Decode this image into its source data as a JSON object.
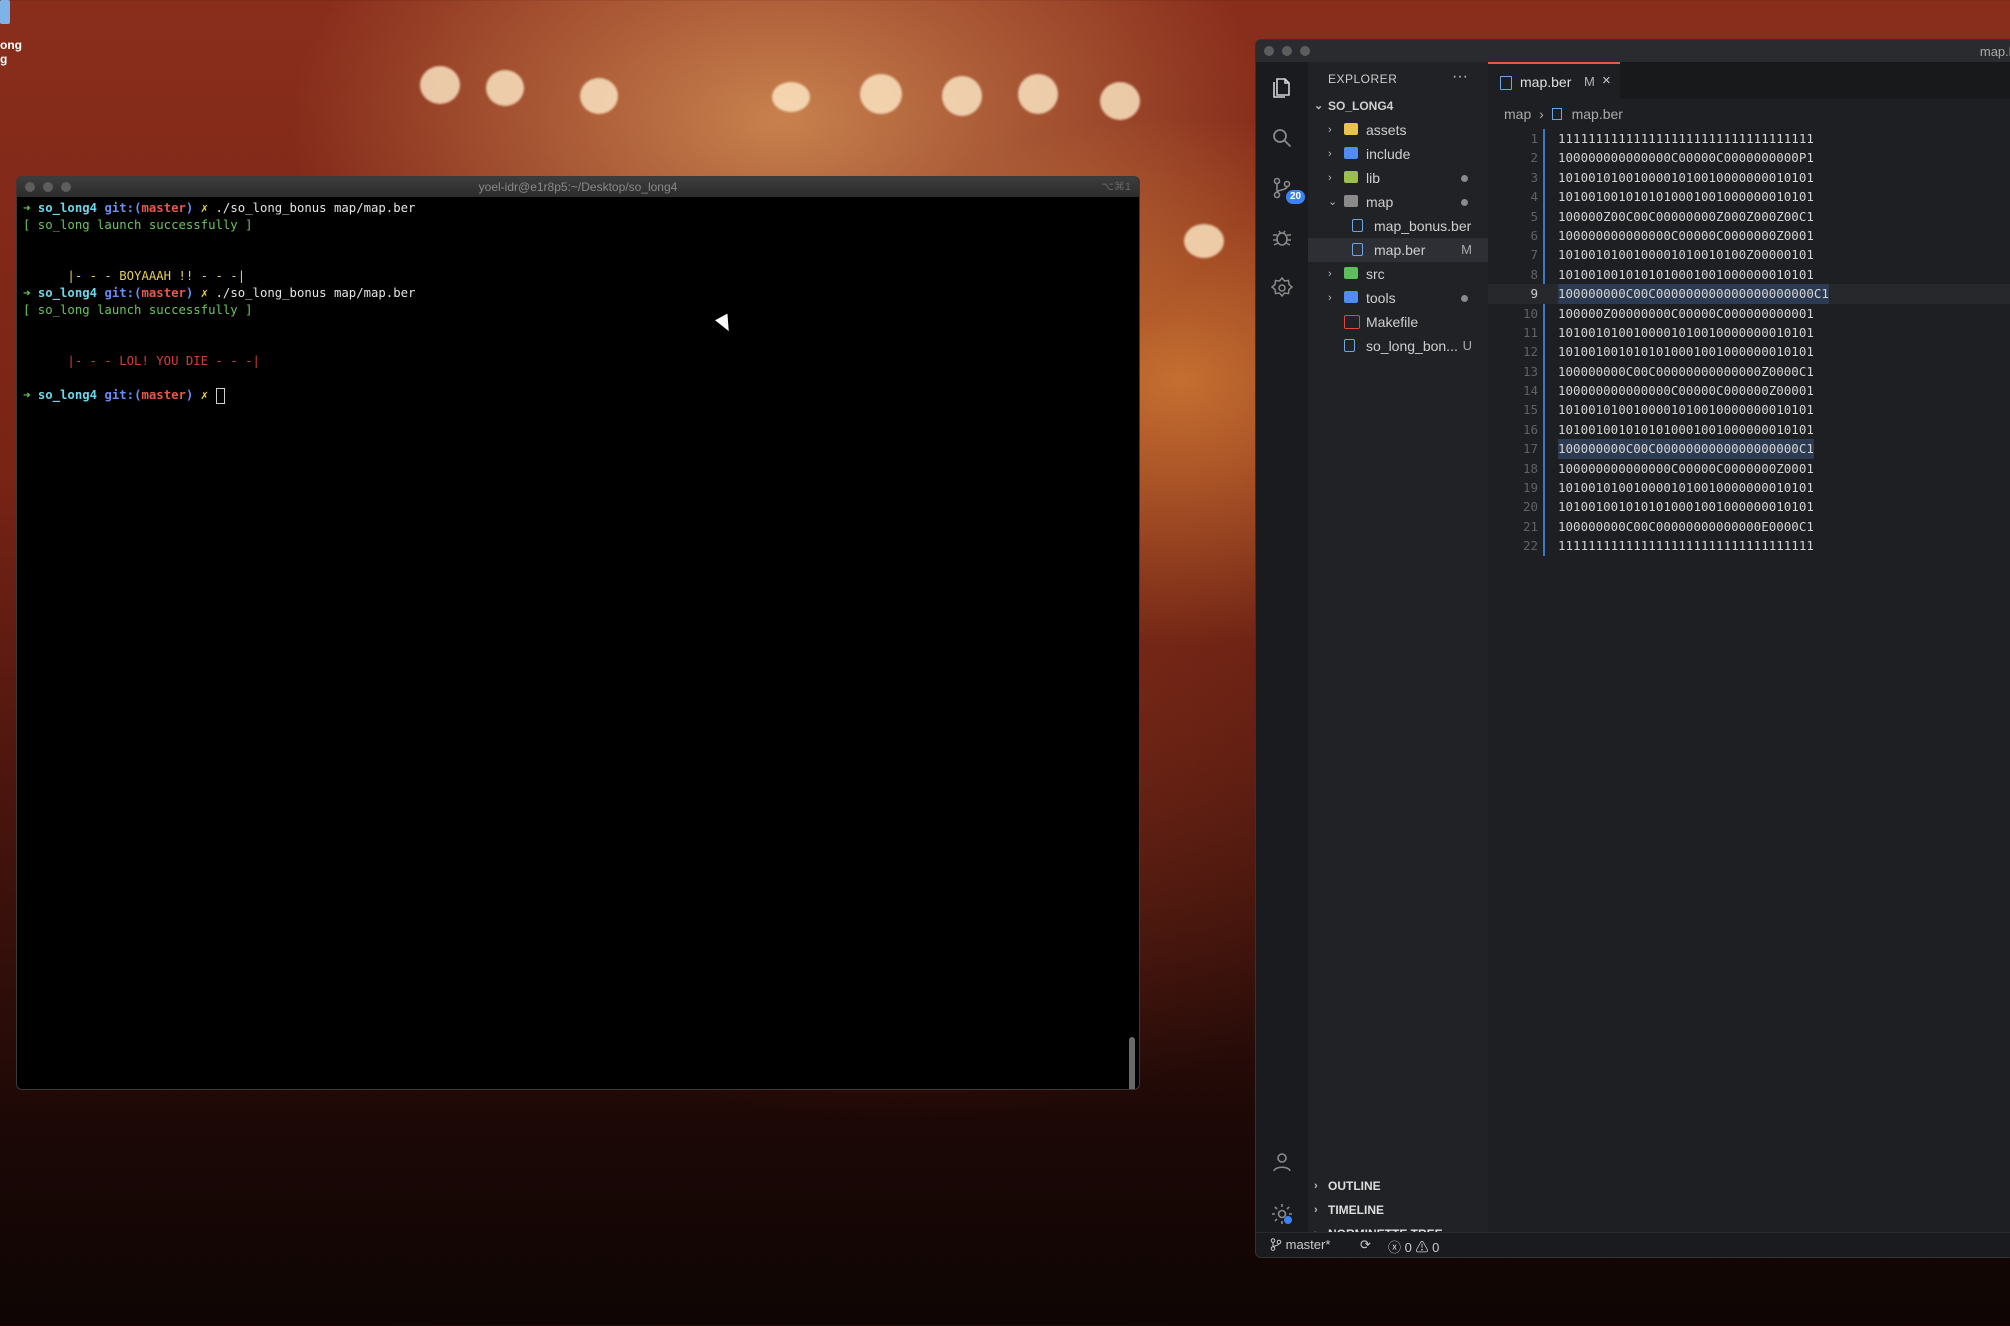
{
  "desktop": {
    "icon_label_line1": "ong",
    "icon_label_line2": "g"
  },
  "terminal": {
    "title": "yoel-idr@e1r8p5:~/Desktop/so_long4",
    "shortcut": "⌥⌘1",
    "prompt": {
      "arrow": "➜",
      "dir": "so_long4",
      "git": "git:(",
      "branch": "master",
      "git_close": ")",
      "dirty": "✗"
    },
    "lines": [
      {
        "kind": "cmd",
        "command": " ./so_long_bonus map/map.ber"
      },
      {
        "kind": "green",
        "text": "[ so_long launch successfully ]"
      },
      {
        "kind": "blank",
        "text": ""
      },
      {
        "kind": "blank",
        "text": ""
      },
      {
        "kind": "yellow",
        "text": "      |- - - BOYAAAH !! - - -|"
      },
      {
        "kind": "cmd",
        "command": " ./so_long_bonus map/map.ber"
      },
      {
        "kind": "green",
        "text": "[ so_long launch successfully ]"
      },
      {
        "kind": "blank",
        "text": ""
      },
      {
        "kind": "blank",
        "text": ""
      },
      {
        "kind": "red",
        "text": "      |- - - LOL! YOU DIE - - -|"
      },
      {
        "kind": "blank",
        "text": ""
      },
      {
        "kind": "cursor",
        "command": " "
      }
    ]
  },
  "vscode": {
    "window_title": "map.b",
    "activity": {
      "scm_badge": "20"
    },
    "explorer": {
      "header": "EXPLORER",
      "more": "···",
      "root": "SO_LONG4",
      "items": [
        {
          "name": "assets",
          "type": "folder",
          "color": "#e8c44a",
          "status": ""
        },
        {
          "name": "include",
          "type": "folder",
          "color": "#4f8ef0",
          "status": ""
        },
        {
          "name": "lib",
          "type": "folder",
          "color": "#9bbf4a",
          "status": "dot"
        },
        {
          "name": "map",
          "type": "folder-open",
          "color": "#8a8a8a",
          "status": "dot"
        },
        {
          "name": "map_bonus.ber",
          "type": "file",
          "color": "#6ea6e4",
          "status": ""
        },
        {
          "name": "map.ber",
          "type": "file",
          "color": "#6ea6e4",
          "status": "M"
        },
        {
          "name": "src",
          "type": "folder",
          "color": "#5bbf5b",
          "status": ""
        },
        {
          "name": "tools",
          "type": "folder",
          "color": "#4f8ef0",
          "status": "dot"
        },
        {
          "name": "Makefile",
          "type": "makefile",
          "color": "#e0483e",
          "status": ""
        },
        {
          "name": "so_long_bon...",
          "type": "file",
          "color": "#6ea6e4",
          "status": "U"
        }
      ],
      "sections": [
        "OUTLINE",
        "TIMELINE",
        "NORMINETTE TREE"
      ]
    },
    "tab": {
      "label": "map.ber",
      "modified": "M",
      "close": "×"
    },
    "breadcrumb": {
      "folder": "map",
      "sep": "›",
      "file": "map.ber"
    },
    "current_line": 9,
    "code": [
      "1111111111111111111111111111111111",
      "100000000000000C00000C0000000000P1",
      "1010010100100001010010000000010101",
      "1010010010101010001001000000010101",
      "100000Z00C00C00000000Z000Z000Z00C1",
      "100000000000000C00000C0000000Z0001",
      "1010010100100001010010100Z00000101",
      "1010010010101010001001000000010101",
      "100000000C00C000000000000000000000C1",
      "100000Z00000000C00000C000000000001",
      "1010010100100001010010000000010101",
      "1010010010101010001001000000010101",
      "100000000C00C00000000000000Z0000C1",
      "100000000000000C00000C000000Z00001",
      "1010010100100001010010000000010101",
      "1010010010101010001001000000010101",
      "100000000C00C0000000000000000000C1",
      "100000000000000C00000C0000000Z0001",
      "1010010100100001010010000000010101",
      "1010010010101010001001000000010101",
      "100000000C00C00000000000000E0000C1",
      "1111111111111111111111111111111111"
    ],
    "status": {
      "branch": "master*",
      "errors": "0",
      "warnings": "0"
    }
  }
}
